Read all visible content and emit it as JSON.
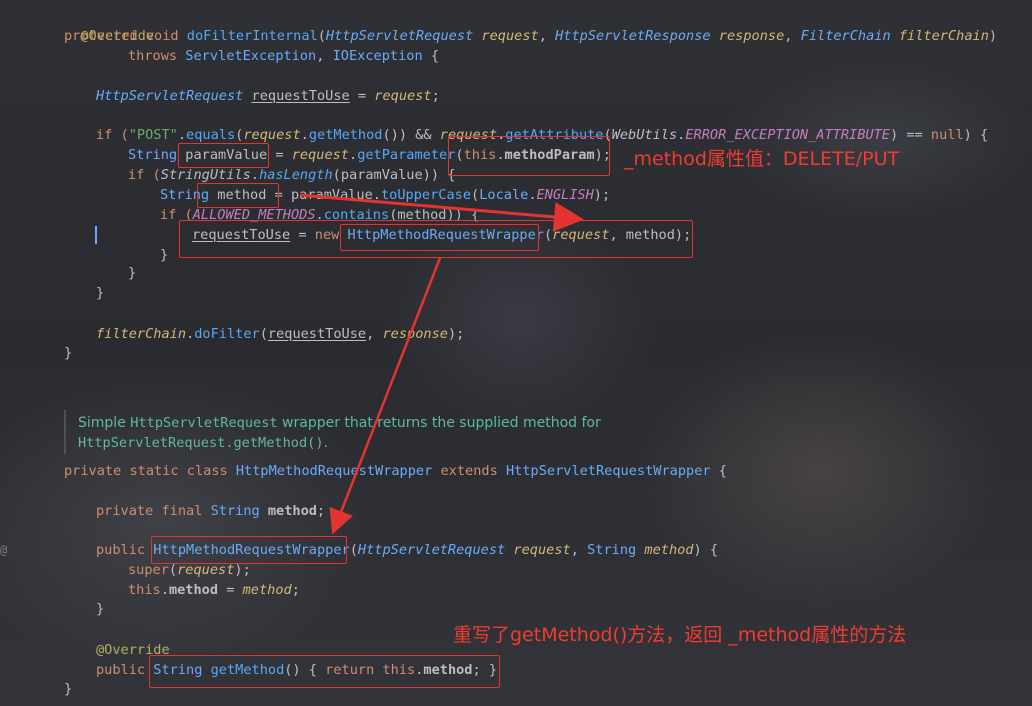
{
  "editor": {
    "gutter_marker": "@",
    "lines": {
      "l1": "@Override",
      "l2_kw": "protected void ",
      "l2_meth": "doFilterInternal",
      "l2_open": "(",
      "l2_t1": "HttpServletRequest",
      "l2_p1": " request",
      "l2_c1": ", ",
      "l2_t2": "HttpServletResponse",
      "l2_p2": " response",
      "l2_c2": ", ",
      "l2_t3": "FilterChain",
      "l2_p3": " filterChain",
      "l2_close": ")",
      "l3_kw": "throws ",
      "l3_t1": "ServletException",
      "l3_c": ", ",
      "l3_t2": "IOException",
      "l3_end": " {",
      "l4_t": "HttpServletRequest",
      "l4_sp": " ",
      "l4_v": "requestToUse",
      "l4_eq": " = ",
      "l4_p": "request",
      "l4_end": ";",
      "l5_if": "if (",
      "l5_str": "\"POST\"",
      "l5_dot": ".",
      "l5_m1": "equals",
      "l5_a": "(",
      "l5_p1": "request",
      "l5_b": ".",
      "l5_m2": "getMethod",
      "l5_c": "()) && ",
      "l5_p2": "request",
      "l5_d": ".",
      "l5_m3": "getAttribute",
      "l5_e": "(",
      "l5_t": "WebUtils",
      "l5_f": ".",
      "l5_fld": "ERROR_EXCEPTION_ATTRIBUTE",
      "l5_g": ") == ",
      "l5_null": "null",
      "l5_h": ") {",
      "l6_t": "String",
      "l6_v": " paramValue",
      "l6_eq": " = ",
      "l6_p": "request",
      "l6_dot": ".",
      "l6_m": "getParameter",
      "l6_a": "(",
      "l6_this": "this",
      "l6_dot2": ".",
      "l6_f": "methodParam",
      "l6_end": ");",
      "l7_if": "if (",
      "l7_t": "StringUtils",
      "l7_dot": ".",
      "l7_m": "hasLength",
      "l7_end": "(paramValue)) {",
      "l8_t": "String",
      "l8_v": " method",
      "l8_eq": " = paramValue.",
      "l8_m": "toUpperCase",
      "l8_a": "(",
      "l8_t2": "Locale",
      "l8_dot": ".",
      "l8_f": "ENGLISH",
      "l8_end": ");",
      "l9_if": "if (",
      "l9_f": "ALLOWED_METHODS",
      "l9_dot": ".",
      "l9_m": "contains",
      "l9_end": "(method)) {",
      "l10_v": "requestToUse",
      "l10_eq": " = ",
      "l10_new": "new ",
      "l10_t": "HttpMethodRequestWrapper",
      "l10_a": "(",
      "l10_p": "request",
      "l10_end": ", method);",
      "l11": "}",
      "l12": "}",
      "l13": "}",
      "l14_p": "filterChain",
      "l14_dot": ".",
      "l14_m": "doFilter",
      "l14_a": "(",
      "l14_v": "requestToUse",
      "l14_c": ", ",
      "l14_p2": "response",
      "l14_end": ");",
      "l15": "}",
      "l16_kw": "private static class ",
      "l16_t": "HttpMethodRequestWrapper",
      "l16_ext": " extends ",
      "l16_t2": "HttpServletRequestWrapper",
      "l16_end": " {",
      "l17_kw": "private final ",
      "l17_t": "String",
      "l17_f": " method",
      "l17_end": ";",
      "l18_kw": "public ",
      "l18_t": "HttpMethodRequestWrapper",
      "l18_a": "(",
      "l18_t2": "HttpServletRequest",
      "l18_p": " request",
      "l18_c": ", ",
      "l18_t3": "String",
      "l18_p2": " method",
      "l18_end": ") {",
      "l19_kw": "super",
      "l19_a": "(",
      "l19_p": "request",
      "l19_end": ");",
      "l20_this": "this",
      "l20_dot": ".",
      "l20_f": "method",
      "l20_eq": " = ",
      "l20_p": "method",
      "l20_end": ";",
      "l21": "}",
      "l22": "@Override",
      "l23_kw": "public ",
      "l23_t": "String",
      "l23_m": " getMethod",
      "l23_a": "() { ",
      "l23_ret": "return this",
      "l23_dot": ".",
      "l23_f": "method",
      "l23_end": "; }",
      "l24": "}"
    },
    "doc": {
      "d1_a": "Simple ",
      "d1_code": "HttpServletRequest",
      "d1_b": " wrapper that returns the supplied method for",
      "d2_code": "HttpServletRequest.getMethod()",
      "d2_end": "."
    }
  },
  "annotations": {
    "note1": "_method属性值：DELETE/PUT",
    "note2": "重写了getMethod()方法，返回 _method属性的方法"
  },
  "colors": {
    "keyword": "#cf8e6d",
    "type": "#6aabf7",
    "method": "#56a8f5",
    "string": "#6aab73",
    "annotation_red": "#f23b30"
  }
}
